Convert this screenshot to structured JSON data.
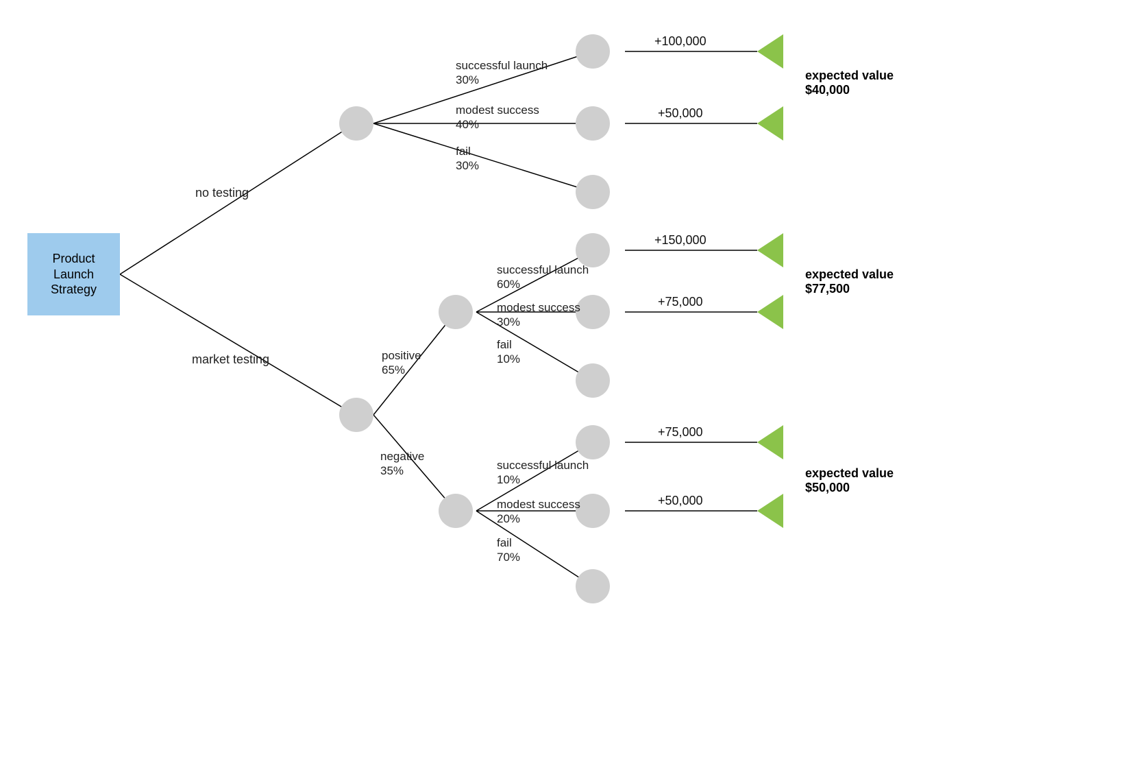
{
  "root": {
    "label": "Product\nLaunch\nStrategy"
  },
  "branches": {
    "no_testing": {
      "label": "no testing",
      "outcomes": {
        "success": {
          "label": "successful launch",
          "prob": "30%",
          "value": "+100,000"
        },
        "modest": {
          "label": "modest success",
          "prob": "40%",
          "value": "+50,000"
        },
        "fail": {
          "label": "fail",
          "prob": "30%"
        }
      },
      "expected_value": {
        "title": "expected value",
        "amount": "$40,000"
      }
    },
    "market_testing": {
      "label": "market testing",
      "sub": {
        "positive": {
          "label": "positive",
          "prob": "65%",
          "outcomes": {
            "success": {
              "label": "successful launch",
              "prob": "60%",
              "value": "+150,000"
            },
            "modest": {
              "label": "modest success",
              "prob": "30%",
              "value": "+75,000"
            },
            "fail": {
              "label": "fail",
              "prob": "10%"
            }
          },
          "expected_value": {
            "title": "expected value",
            "amount": "$77,500"
          }
        },
        "negative": {
          "label": "negative",
          "prob": "35%",
          "outcomes": {
            "success": {
              "label": "successful launch",
              "prob": "10%",
              "value": "+75,000"
            },
            "modest": {
              "label": "modest success",
              "prob": "20%",
              "value": "+50,000"
            },
            "fail": {
              "label": "fail",
              "prob": "70%"
            }
          },
          "expected_value": {
            "title": "expected value",
            "amount": "$50,000"
          }
        }
      }
    }
  },
  "colors": {
    "root": "#9ecbed",
    "node": "#cfcfcf",
    "triangle": "#8bc34a"
  }
}
